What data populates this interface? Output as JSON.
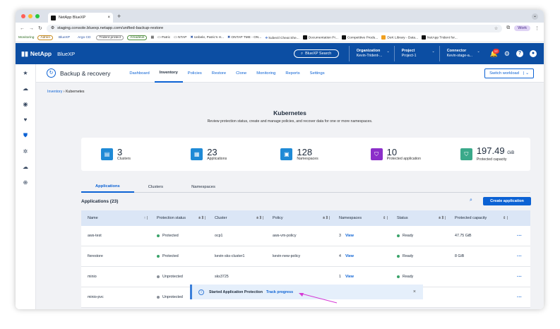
{
  "browser": {
    "tab_title": "NetApp BlueXP",
    "url": "staging.console.bluexp.netapp.com/unified-backup-restore",
    "profile": "Work",
    "bookmarks": [
      "Monitoring",
      "Admin",
      "BlueXP",
      "Argo CD",
      "Trident protect",
      "Amadeus",
      "Patric",
      "NTAP",
      "Uebele, Patric's H...",
      "ONTAP TME - ON...",
      "kubectl Cheat She...",
      "Documentation Pr...",
      "Competitive Produ...",
      "DoK Library - Data...",
      "NetApp Trident for..."
    ]
  },
  "header": {
    "brand": "NetApp",
    "product": "BlueXP",
    "search_label": "BlueXP Search",
    "organization": {
      "label": "Organization",
      "value": "Kevin-Trident-..."
    },
    "project": {
      "label": "Project",
      "value": "Project-1"
    },
    "connector": {
      "label": "Connector",
      "value": "Kevin-stage-a..."
    },
    "notification_count": "12"
  },
  "appnav": {
    "title": "Backup & recovery",
    "tabs": [
      "Dashboard",
      "Inventory",
      "Policies",
      "Restore",
      "Clone",
      "Monitoring",
      "Reports",
      "Settings"
    ],
    "selected_tab": "Inventory",
    "switch_workload": "Switch workload"
  },
  "breadcrumb": {
    "root": "Inventory",
    "current": "Kubernetes"
  },
  "page": {
    "title": "Kubernetes",
    "subtitle": "Review protection status, create and manage policies, and recover data for one or more namespaces."
  },
  "stats": [
    {
      "value": "3",
      "unit": "",
      "label": "Clusters",
      "color": "#1f8ad6",
      "icon": "cluster-icon"
    },
    {
      "value": "23",
      "unit": "",
      "label": "Applications",
      "color": "#1f8ad6",
      "icon": "apps-icon"
    },
    {
      "value": "128",
      "unit": "",
      "label": "Namespaces",
      "color": "#1f8ad6",
      "icon": "namespace-icon"
    },
    {
      "value": "10",
      "unit": "",
      "label": "Protected application",
      "color": "#8b2fc9",
      "icon": "shield-icon"
    },
    {
      "value": "197.49",
      "unit": "GiB",
      "label": "Protected capacity",
      "color": "#3aa98a",
      "icon": "shield-check-icon"
    }
  ],
  "subtabs": [
    "Applications",
    "Clusters",
    "Namespaces"
  ],
  "selected_subtab": "Applications",
  "apps_heading": "Applications (23)",
  "create_button": "Create application",
  "table": {
    "columns": [
      "Name",
      "Protection status",
      "Cluster",
      "Policy",
      "Namespaces",
      "Status",
      "Protected capacity"
    ],
    "rows": [
      {
        "name": "aws-test",
        "protection": "Protected",
        "cluster": "ocp1",
        "policy": "aws-vm-policy",
        "namespaces": "3",
        "status": "Ready",
        "capacity": "47.75 GiB"
      },
      {
        "name": "fixrestore",
        "protection": "Protected",
        "cluster": "kevin-sks-cluster1",
        "policy": "kevin-new-policy",
        "namespaces": "4",
        "status": "Ready",
        "capacity": "8 GiB"
      },
      {
        "name": "minio",
        "protection": "Unprotected",
        "cluster": "sks3725",
        "policy": "",
        "namespaces": "1",
        "status": "Ready",
        "capacity": ""
      },
      {
        "name": "minio-pvc",
        "protection": "Unprotected",
        "cluster": "",
        "policy": "",
        "namespaces": "",
        "status": "",
        "capacity": ""
      }
    ],
    "view_label": "View"
  },
  "colors": {
    "protected": "#3aa36a",
    "unprotected": "#8a8f98",
    "ready": "#3aa36a"
  },
  "toast": {
    "message": "Started Application Protection",
    "link": "Track progress"
  }
}
